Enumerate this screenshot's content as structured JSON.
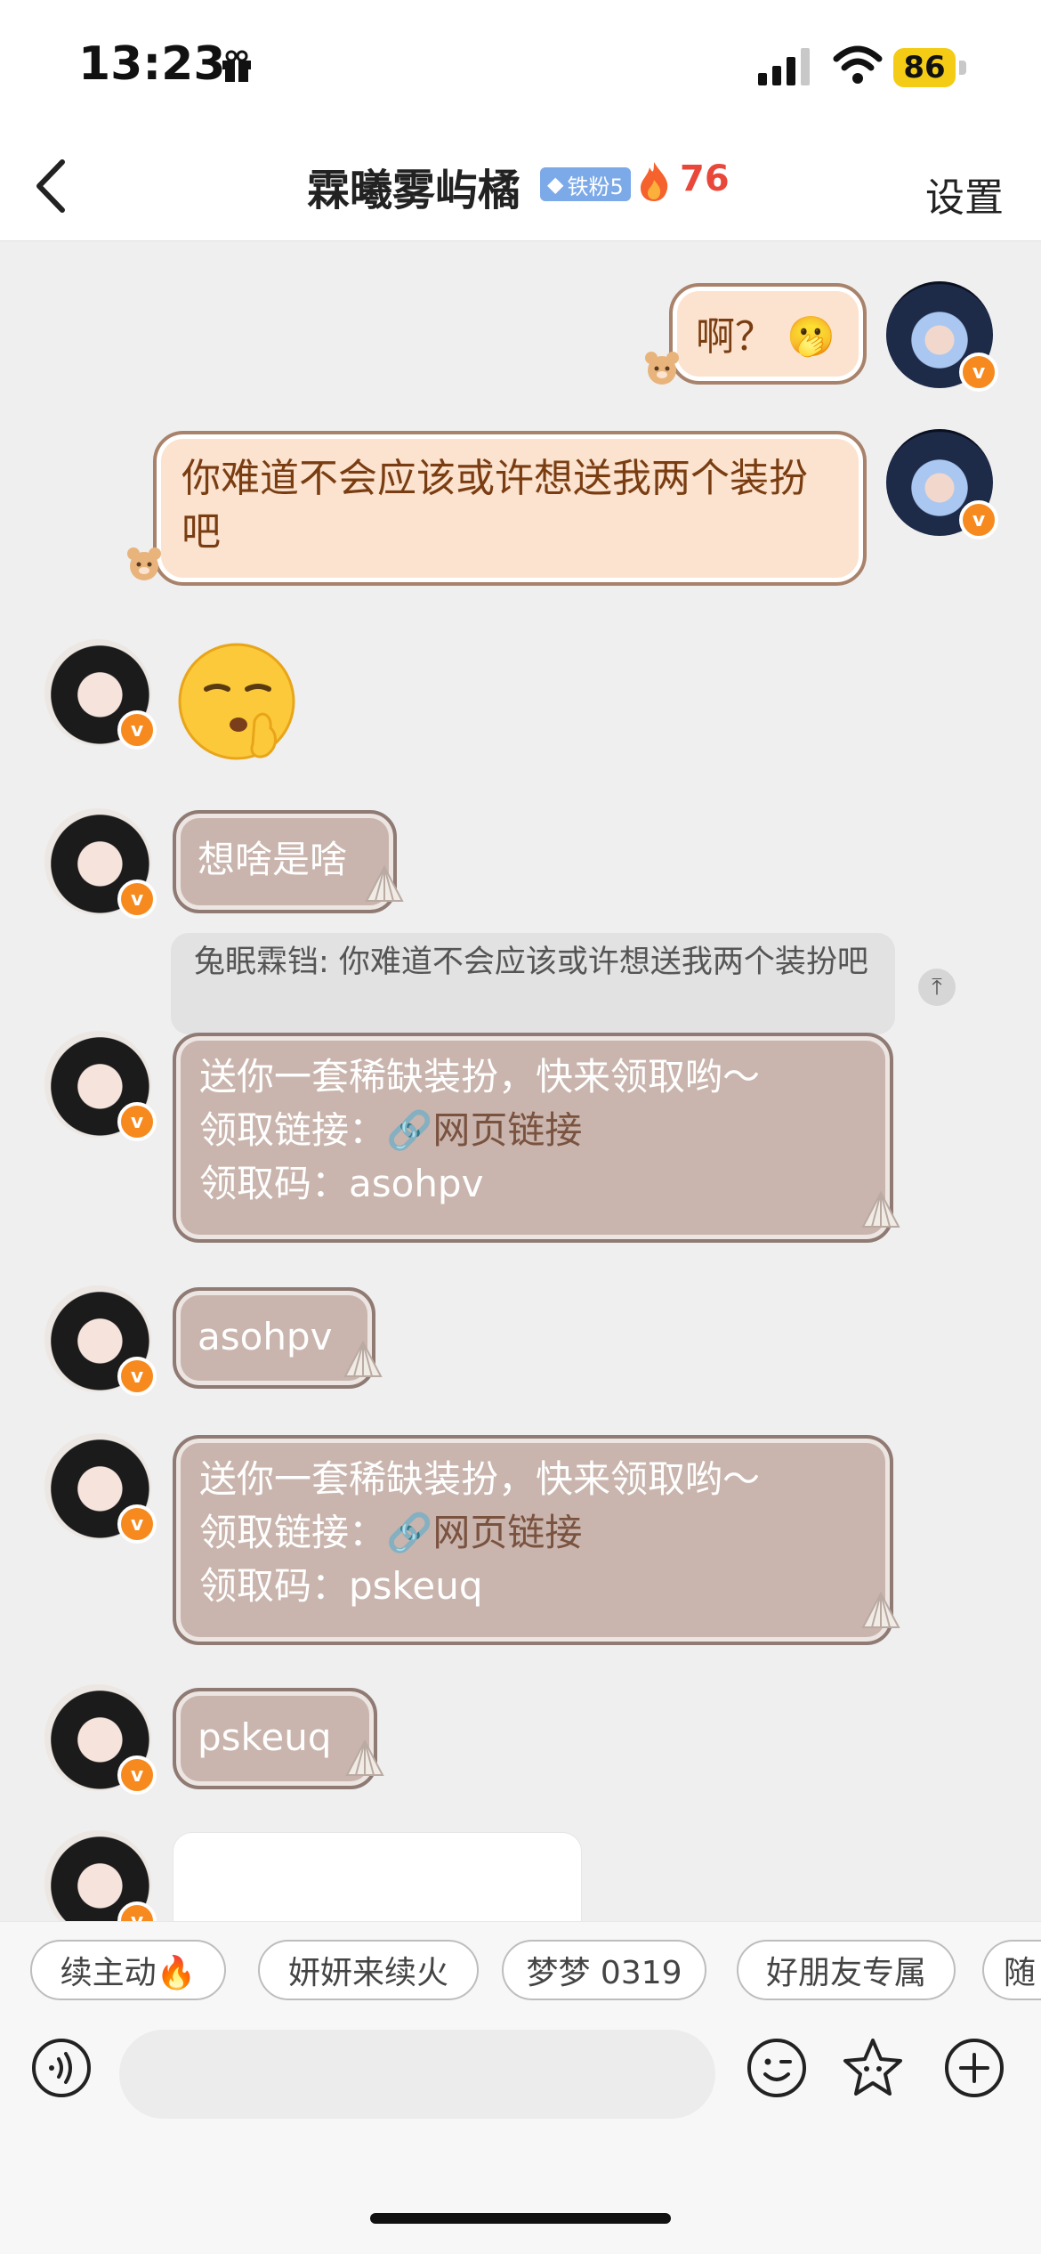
{
  "status": {
    "time": "13:23",
    "battery": "86"
  },
  "nav": {
    "title": "霖曦雾屿橘",
    "fan_badge": "铁粉5",
    "heat": "76",
    "settings": "设置"
  },
  "messages": {
    "m1": "啊？ 🫢",
    "m2": "你难道不会应该或许想送我两个装扮吧",
    "m4": "想啥是啥",
    "quote": "兔眠霖铛: 你难道不会应该或许想送我两个装扮吧",
    "gift1": {
      "line1": "送你一套稀缺装扮，快来领取哟～",
      "link_label": "领取链接：",
      "link_text": "网页链接",
      "code_line": "领取码：asohpv"
    },
    "m6": "asohpv",
    "gift2": {
      "line1": "送你一套稀缺装扮，快来领取哟～",
      "link_label": "领取链接：",
      "link_text": "网页链接",
      "code_line": "领取码：pskeuq"
    },
    "m8": "pskeuq"
  },
  "chips": [
    "续主动🔥",
    "妍妍来续火",
    "梦梦 0319",
    "好朋友专属",
    "随"
  ],
  "colors": {
    "accent": "#f68a1e",
    "heat": "#e8473a",
    "warm_bubble": "#fbe3cf",
    "cool_bubble": "#c9b5ad"
  }
}
